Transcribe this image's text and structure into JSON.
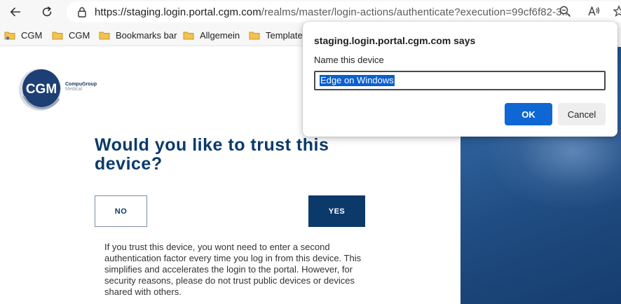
{
  "browser": {
    "url_host": "https://staging.login.portal.cgm.com",
    "url_path": "/realms/master/login-actions/authenticate?execution=99cf6f82-3..."
  },
  "bookmarks": [
    {
      "label": "CGM"
    },
    {
      "label": "CGM"
    },
    {
      "label": "Bookmarks bar"
    },
    {
      "label": "Allgemein"
    },
    {
      "label": "Template"
    }
  ],
  "logo": {
    "mark": "CGM",
    "company": "CompuGroup",
    "company_sub": "Medical"
  },
  "page": {
    "heading": "Would you like to trust this device?",
    "no_label": "NO",
    "yes_label": "YES",
    "info": "If you trust this device, you wont need to enter a second authentication factor every time you log in from this device. This simplifies and accelerates the login to the portal. However, for security reasons, please do not trust public devices or devices shared with others."
  },
  "dialog": {
    "title": "staging.login.portal.cgm.com says",
    "message": "Name this device",
    "input_value": "Edge on Windows",
    "ok_label": "OK",
    "cancel_label": "Cancel"
  },
  "colors": {
    "brand_navy": "#0b3a6a",
    "dialog_ok": "#0e67d3",
    "selection": "#0a5fd0"
  }
}
